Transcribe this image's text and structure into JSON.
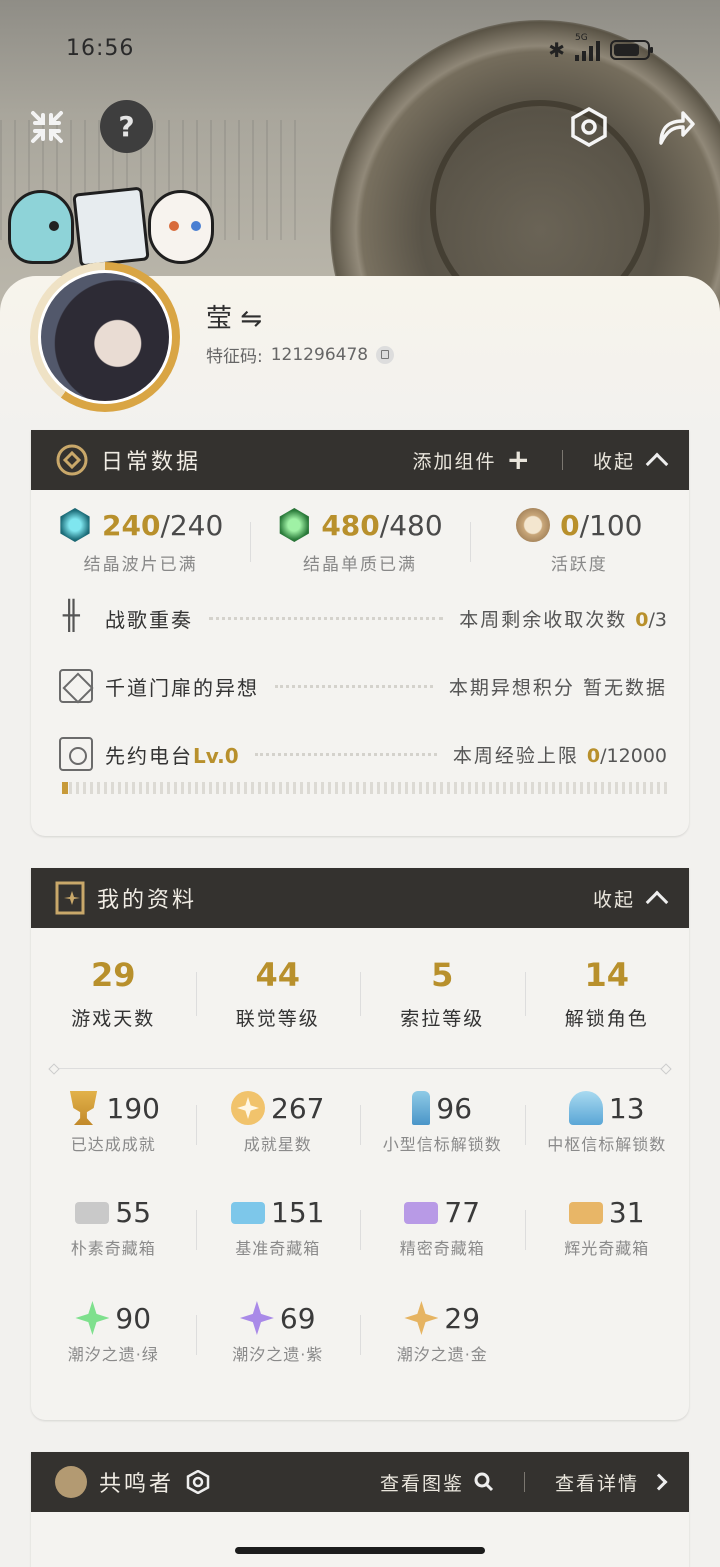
{
  "status": {
    "time": "16:56",
    "network": "5G"
  },
  "header": {
    "help_label": "?"
  },
  "profile": {
    "name": "莹 ⇋",
    "id_label": "特征码:",
    "id_value": "121296478"
  },
  "daily": {
    "title": "日常数据",
    "add_widget": "添加组件",
    "collapse": "收起",
    "resources": [
      {
        "icon": "blue-crystal-icon",
        "current": "240",
        "max": "/240",
        "label": "结晶波片已满"
      },
      {
        "icon": "green-crystal-icon",
        "current": "480",
        "max": "/480",
        "label": "结晶单质已满"
      },
      {
        "icon": "activity-coin-icon",
        "current": "0",
        "max": "/100",
        "label": "活跃度"
      }
    ],
    "tasks": [
      {
        "name": "战歌重奏",
        "info": "本周剩余收取次数",
        "num": "0",
        "total": "/3"
      },
      {
        "name": "千道门扉的异想",
        "info": "本期异想积分",
        "value": "暂无数据"
      },
      {
        "name": "先约电台",
        "level": "Lv.0",
        "info": "本周经验上限",
        "num": "0",
        "total": "/12000"
      }
    ],
    "radio_progress": 0.01
  },
  "info": {
    "title": "我的资料",
    "collapse": "收起",
    "top_stats": [
      {
        "value": "29",
        "label": "游戏天数"
      },
      {
        "value": "44",
        "label": "联觉等级"
      },
      {
        "value": "5",
        "label": "索拉等级"
      },
      {
        "value": "14",
        "label": "解锁角色"
      }
    ],
    "stats": [
      {
        "icon": "trophy-icon",
        "value": "190",
        "label": "已达成成就"
      },
      {
        "icon": "achievement-star-icon",
        "value": "267",
        "label": "成就星数"
      },
      {
        "icon": "small-beacon-icon",
        "value": "96",
        "label": "小型信标解锁数"
      },
      {
        "icon": "hub-beacon-icon",
        "value": "13",
        "label": "中枢信标解锁数"
      },
      {
        "icon": "basic-chest-icon",
        "value": "55",
        "label": "朴素奇藏箱"
      },
      {
        "icon": "standard-chest-icon",
        "value": "151",
        "label": "基准奇藏箱"
      },
      {
        "icon": "exquisite-chest-icon",
        "value": "77",
        "label": "精密奇藏箱"
      },
      {
        "icon": "radiant-chest-icon",
        "value": "31",
        "label": "辉光奇藏箱"
      },
      {
        "icon": "green-tide-star-icon",
        "value": "90",
        "label": "潮汐之遗·绿"
      },
      {
        "icon": "purple-tide-star-icon",
        "value": "69",
        "label": "潮汐之遗·紫"
      },
      {
        "icon": "gold-tide-star-icon",
        "value": "29",
        "label": "潮汐之遗·金"
      }
    ]
  },
  "resonators": {
    "title": "共鸣者",
    "view_codex": "查看图鉴",
    "view_details": "查看详情"
  },
  "colors": {
    "accent": "#b8902c",
    "header_bg": "#34322f",
    "panel_bg": "#f4f3f0"
  }
}
